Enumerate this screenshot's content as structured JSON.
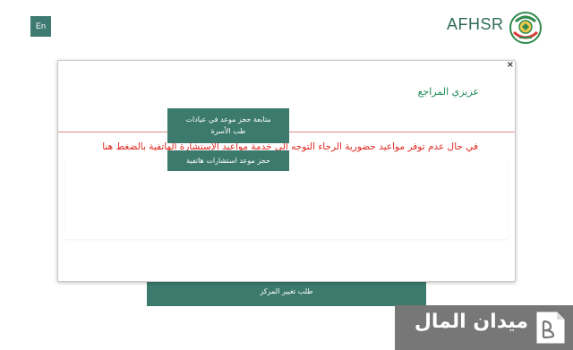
{
  "header": {
    "lang_label": "En",
    "brand_text": "AFHSR",
    "logo_icon": "afhsr-emblem-icon"
  },
  "background": {
    "change_center_label": "طلب تغيير المركز"
  },
  "modal": {
    "close_label": "×",
    "title": "عزيزي المراجع",
    "message": "في حال عدم توفر مواعيد حضورية الرجاء التوجه الى خدمة مواعيد الإستشارة الهاتفية بالضغط هنا",
    "buttons": [
      {
        "line1": "متابعة حجز موعد في عيادات",
        "line2": "طب الأسرة"
      },
      {
        "label": "حجز موعد استشارات هاتفية"
      }
    ]
  },
  "watermark": {
    "text": "ميدان المال",
    "icon": "currency-document-icon"
  },
  "colors": {
    "accent": "#3d7a6e",
    "brand": "#2f6b58",
    "alert": "#e0261f",
    "title_green": "#1f8a5a"
  }
}
